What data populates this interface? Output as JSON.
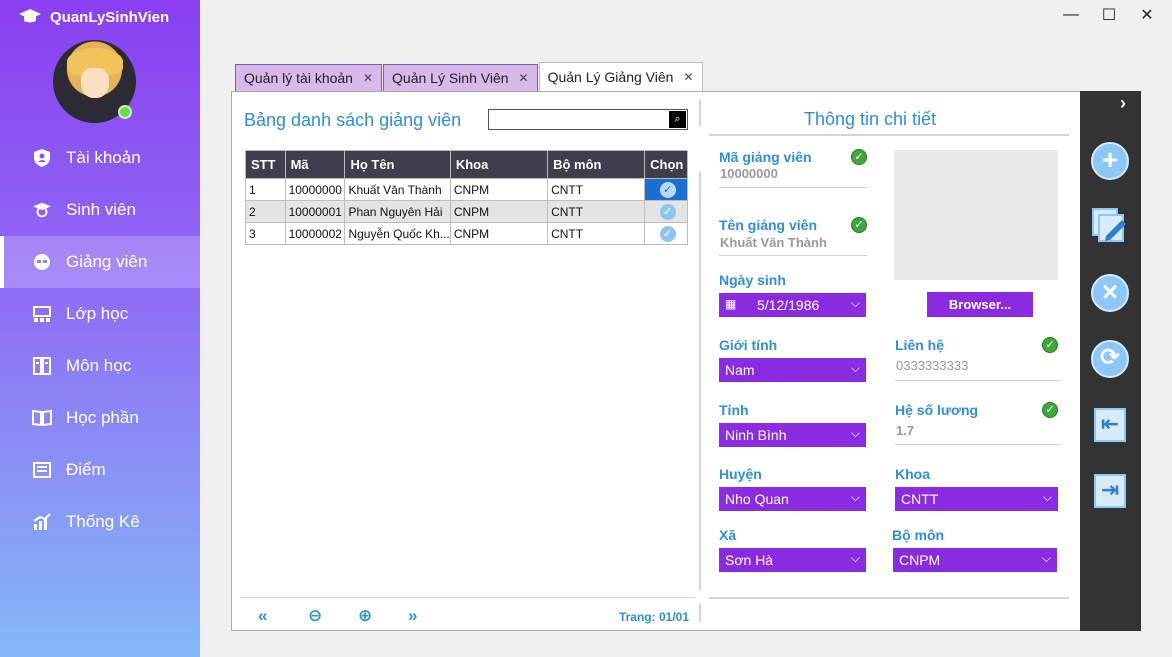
{
  "app": {
    "title": "QuanLySinhVien"
  },
  "window": {
    "minimize": "—",
    "maximize": "☐",
    "close": "✕"
  },
  "sidebar": {
    "items": [
      {
        "label": "Tài khoản",
        "icon": "shield-user-icon"
      },
      {
        "label": "Sinh viên",
        "icon": "student-icon"
      },
      {
        "label": "Giảng viên",
        "icon": "teacher-icon",
        "active": true
      },
      {
        "label": "Lớp học",
        "icon": "classroom-icon"
      },
      {
        "label": "Môn học",
        "icon": "subject-icon"
      },
      {
        "label": "Học phần",
        "icon": "book-icon"
      },
      {
        "label": "Điểm",
        "icon": "grade-icon"
      },
      {
        "label": "Thống Kê",
        "icon": "chart-icon"
      }
    ]
  },
  "tabs": [
    {
      "label": "Quản lý tài khoản"
    },
    {
      "label": "Quản Lý Sinh Viên"
    },
    {
      "label": "Quản Lý Giảng Viên",
      "active": true
    }
  ],
  "list": {
    "title": "Bảng danh sách giảng viên",
    "search_value": "",
    "columns": [
      "STT",
      "Mã",
      "Họ Tên",
      "Khoa",
      "Bộ môn",
      "Chọn"
    ],
    "rows": [
      [
        "1",
        "10000000",
        "Khuất Văn Thành",
        "CNPM",
        "CNTT"
      ],
      [
        "2",
        "10000001",
        "Phan Nguyên Hải",
        "CNPM",
        "CNTT"
      ],
      [
        "3",
        "10000002",
        "Nguyễn Quốc Kh...",
        "CNPM",
        "CNTT"
      ]
    ],
    "page_label": "Trang: 01/01"
  },
  "detail": {
    "title": "Thông tin chi tiết",
    "ma_gv_label": "Mã giảng viên",
    "ma_gv_value": "10000000",
    "ten_gv_label": "Tên giảng viên",
    "ten_gv_value": "Khuất Văn Thành",
    "ngay_sinh_label": "Ngày sinh",
    "ngay_sinh_value": "5/12/1986",
    "gioi_tinh_label": "Giới tính",
    "gioi_tinh_value": "Nam",
    "lien_he_label": "Liên hệ",
    "lien_he_value": "0333333333",
    "tinh_label": "Tỉnh",
    "tinh_value": "Ninh Bình",
    "he_so_label": "Hệ số lương",
    "he_so_value": "1.7",
    "huyen_label": "Huyện",
    "huyen_value": "Nho Quan",
    "khoa_label": "Khoa",
    "khoa_value": "CNTT",
    "xa_label": "Xã",
    "xa_value": "Sơn Hà",
    "bo_mon_label": "Bộ môn",
    "bo_mon_value": "CNPM",
    "browse_label": "Browser..."
  },
  "colors": {
    "accent": "#8a2be2",
    "title_blue": "#2d8fd8",
    "header_dark": "#3d3f4c"
  }
}
